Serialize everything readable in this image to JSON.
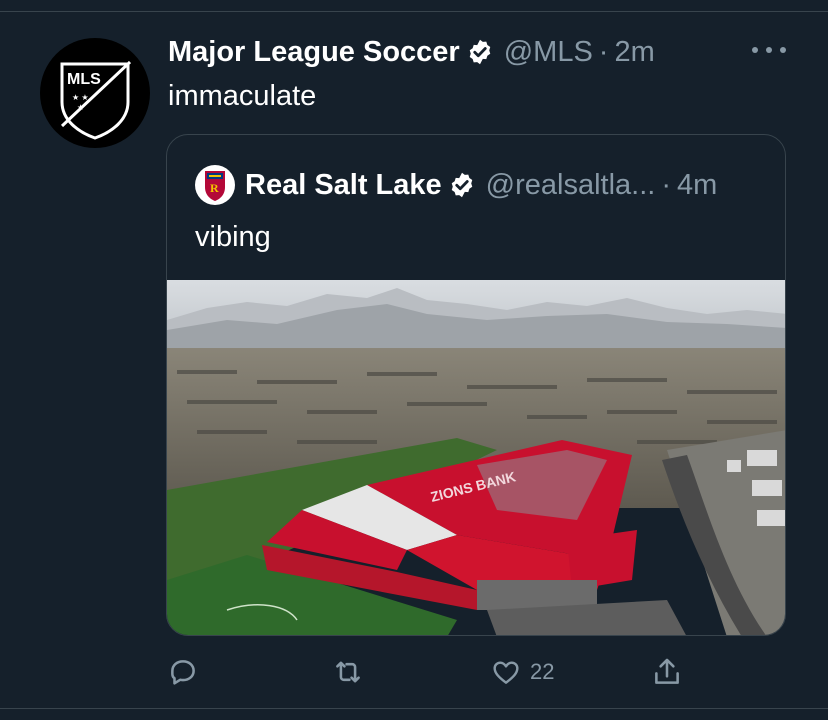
{
  "tweet": {
    "author_name": "Major League Soccer",
    "author_handle": "@MLS",
    "time": "2m",
    "avatar_text": "MLS",
    "text": "immaculate",
    "verified": true
  },
  "quoted_tweet": {
    "author_name": "Real Salt Lake",
    "author_handle": "@realsaltla...",
    "time": "4m",
    "text": "vibing",
    "verified": true,
    "media": {
      "stadium_roof_text": "ZIONS BANK"
    }
  },
  "actions": {
    "reply_icon": "reply-icon",
    "retweet_icon": "retweet-icon",
    "like_icon": "heart-icon",
    "like_count": "22",
    "share_icon": "share-icon"
  },
  "colors": {
    "background": "#15202b",
    "secondary_text": "#8899a6",
    "divider": "#38444d",
    "rsl_red": "#c8102e"
  }
}
